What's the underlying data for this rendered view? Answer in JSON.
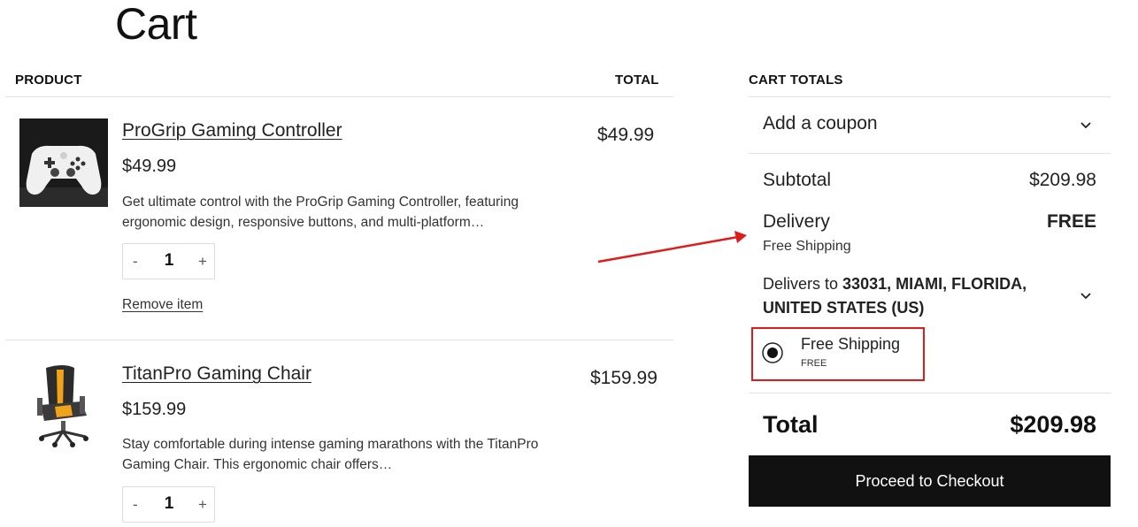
{
  "page": {
    "title": "Cart"
  },
  "table": {
    "col_product": "PRODUCT",
    "col_total": "TOTAL"
  },
  "items": [
    {
      "name": "ProGrip Gaming Controller",
      "price": "$49.99",
      "description": "Get ultimate control with the ProGrip Gaming Controller, featuring ergonomic design, responsive buttons, and multi-platform…",
      "quantity": "1",
      "minus": "-",
      "plus": "+",
      "remove_label": "Remove item",
      "line_total": "$49.99",
      "image_icon": "game-controller-image"
    },
    {
      "name": "TitanPro Gaming Chair",
      "price": "$159.99",
      "description": "Stay comfortable during intense gaming marathons with the TitanPro Gaming Chair. This ergonomic chair offers…",
      "quantity": "1",
      "minus": "-",
      "plus": "+",
      "line_total": "$159.99",
      "image_icon": "gaming-chair-image"
    }
  ],
  "cart_totals": {
    "heading": "CART TOTALS",
    "coupon_label": "Add a coupon",
    "subtotal_label": "Subtotal",
    "subtotal_value": "$209.98",
    "delivery_label": "Delivery",
    "delivery_value": "FREE",
    "delivery_method": "Free Shipping",
    "delivers_to_prefix": "Delivers to",
    "delivers_to_address_line1": "33031, MIAMI, FLORIDA,",
    "delivers_to_address_line2": "UNITED STATES (US)",
    "shipping_option_label": "Free Shipping",
    "shipping_option_price": "FREE",
    "total_label": "Total",
    "total_value": "$209.98",
    "checkout_label": "Proceed to Checkout"
  },
  "colors": {
    "accent_dark": "#111111",
    "annotation_red": "#e01b1b"
  }
}
